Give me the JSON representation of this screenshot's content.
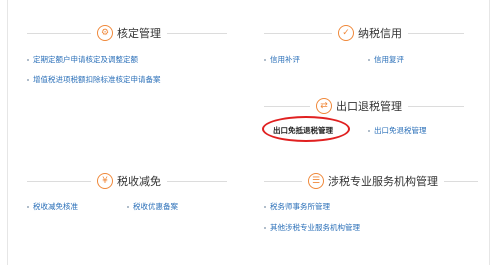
{
  "sections": {
    "verification": {
      "title": "核定管理",
      "icon": "gear-icon",
      "links": [
        "定期定额户申请核定及调整定额",
        "增值税进项税额扣除标准核定申请备案"
      ]
    },
    "credit": {
      "title": "纳税信用",
      "icon": "shield-check-icon",
      "links": [
        "信用补评",
        "信用复评"
      ]
    },
    "export_refund": {
      "title": "出口退税管理",
      "icon": "export-refund-icon",
      "links": [
        "出口免抵退税管理",
        "出口免退税管理"
      ]
    },
    "tax_relief": {
      "title": "税收减免",
      "icon": "tax-relief-icon",
      "links": [
        "税收减免核准",
        "税收优惠备案"
      ]
    },
    "agency": {
      "title": "涉税专业服务机构管理",
      "icon": "agency-icon",
      "links": [
        "税务师事务所管理",
        "其他涉税专业服务机构管理"
      ]
    }
  },
  "colors": {
    "accent": "#f0893b",
    "link": "#2a6fb8",
    "highlight": "#e02020"
  }
}
